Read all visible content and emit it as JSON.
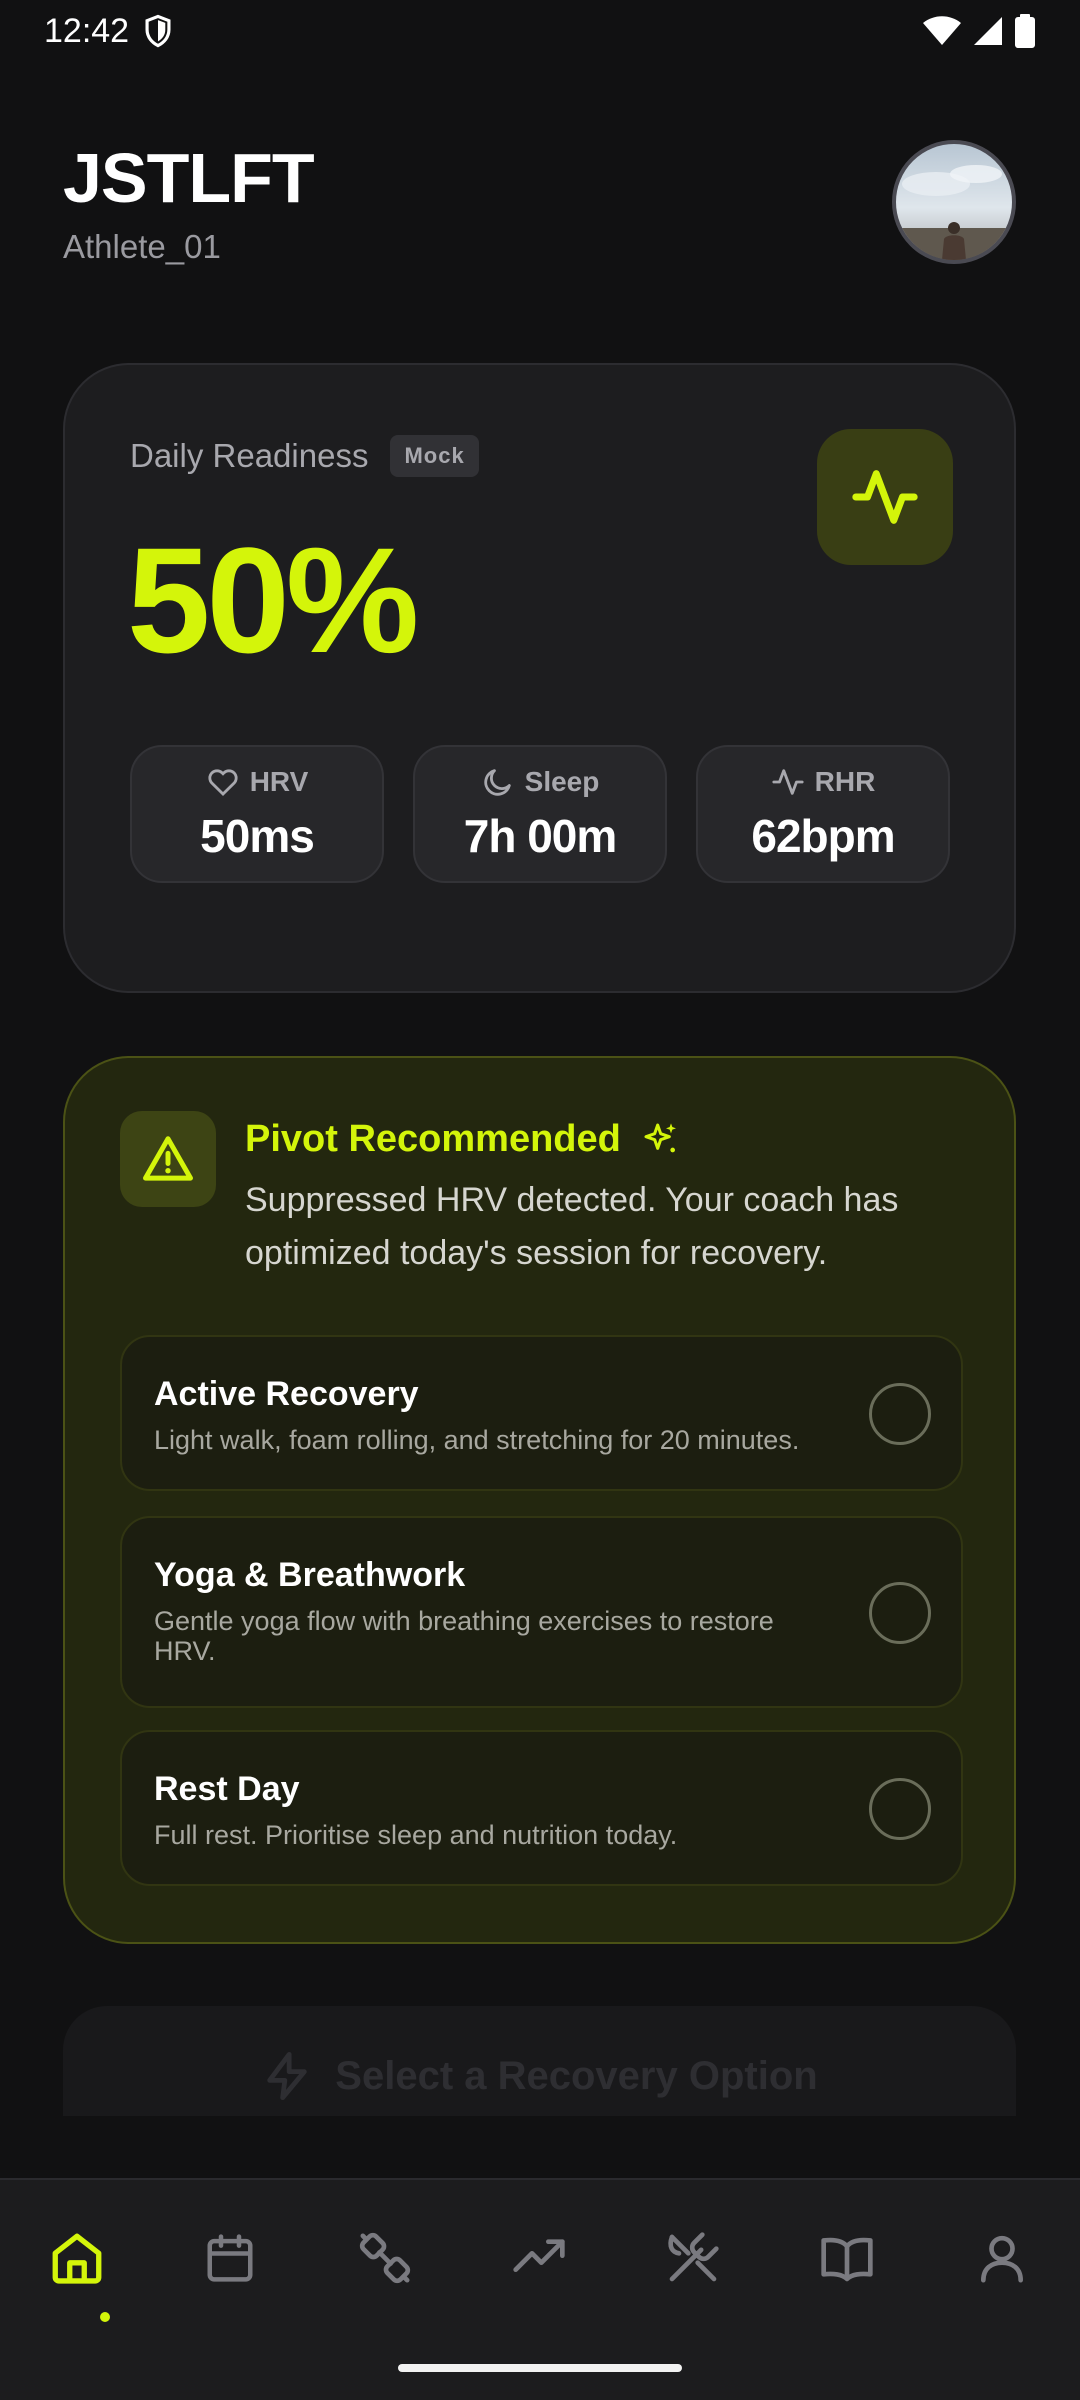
{
  "status_bar": {
    "time": "12:42"
  },
  "header": {
    "title": "JSTLFT",
    "username": "Athlete_01"
  },
  "readiness": {
    "label": "Daily Readiness",
    "badge": "Mock",
    "value": "50%",
    "metrics": [
      {
        "icon": "heart-icon",
        "label": "HRV",
        "value": "50ms"
      },
      {
        "icon": "moon-icon",
        "label": "Sleep",
        "value": "7h 00m"
      },
      {
        "icon": "activity-icon",
        "label": "RHR",
        "value": "62bpm"
      }
    ]
  },
  "pivot": {
    "title": "Pivot Recommended",
    "description": "Suppressed HRV detected. Your coach has optimized today's session for recovery.",
    "options": [
      {
        "title": "Active Recovery",
        "description": "Light walk, foam rolling, and stretching for 20 minutes."
      },
      {
        "title": "Yoga & Breathwork",
        "description": "Gentle yoga flow with breathing exercises to restore HRV."
      },
      {
        "title": "Rest Day",
        "description": "Full rest. Prioritise sleep and nutrition today."
      }
    ]
  },
  "select_button": {
    "label": "Select a Recovery Option"
  },
  "nav": [
    {
      "icon": "home-icon",
      "active": true
    },
    {
      "icon": "calendar-icon"
    },
    {
      "icon": "dumbbell-icon"
    },
    {
      "icon": "trending-up-icon"
    },
    {
      "icon": "utensils-crossed-icon"
    },
    {
      "icon": "book-icon"
    },
    {
      "icon": "user-icon"
    }
  ],
  "colors": {
    "accent": "#d4f50a",
    "background": "#111112",
    "card": "#1d1d1f",
    "pivot_card": "#23270f"
  }
}
